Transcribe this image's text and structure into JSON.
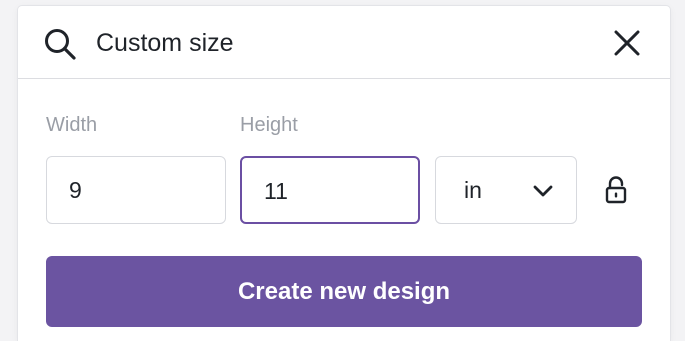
{
  "search": {
    "value": "Custom size",
    "icon": "search-icon"
  },
  "header": {
    "close_icon": "close-icon"
  },
  "size": {
    "width_label": "Width",
    "width_value": "9",
    "height_label": "Height",
    "height_value": "11",
    "unit": "in",
    "unit_icon": "chevron-down-icon",
    "lock_icon": "unlocked-padlock-icon"
  },
  "actions": {
    "create_label": "Create new design"
  },
  "colors": {
    "accent": "#6b54a1",
    "focus_border": "#6b4fa3",
    "label_gray": "#9a9ea6",
    "text": "#1f2329"
  }
}
